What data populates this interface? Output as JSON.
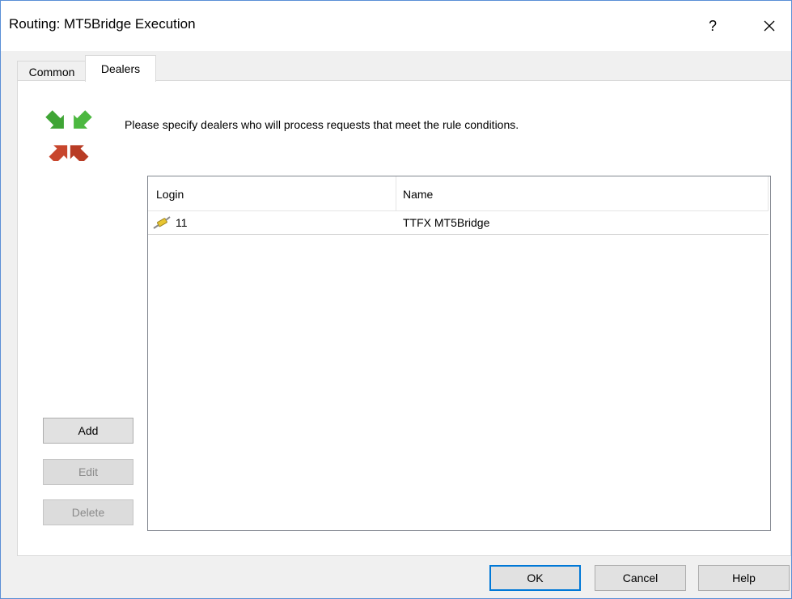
{
  "window": {
    "title": "Routing: MT5Bridge Execution",
    "help_label": "?",
    "close_icon": "close-icon"
  },
  "tabs": [
    {
      "label": "Common",
      "selected": false
    },
    {
      "label": "Dealers",
      "selected": true
    }
  ],
  "dealers": {
    "instruction": "Please specify dealers who will process requests that meet the rule conditions.",
    "columns": {
      "login": "Login",
      "name": "Name"
    },
    "rows": [
      {
        "icon": "connector-icon",
        "login": "11",
        "name": "TTFX MT5Bridge"
      }
    ],
    "buttons": {
      "add": "Add",
      "edit": "Edit",
      "delete": "Delete"
    }
  },
  "footer": {
    "ok": "OK",
    "cancel": "Cancel",
    "help": "Help"
  },
  "colors": {
    "accent": "#0078d7",
    "window_border": "#5a8fd6",
    "arrow_green": "#3fa535",
    "arrow_red": "#c8462d"
  }
}
